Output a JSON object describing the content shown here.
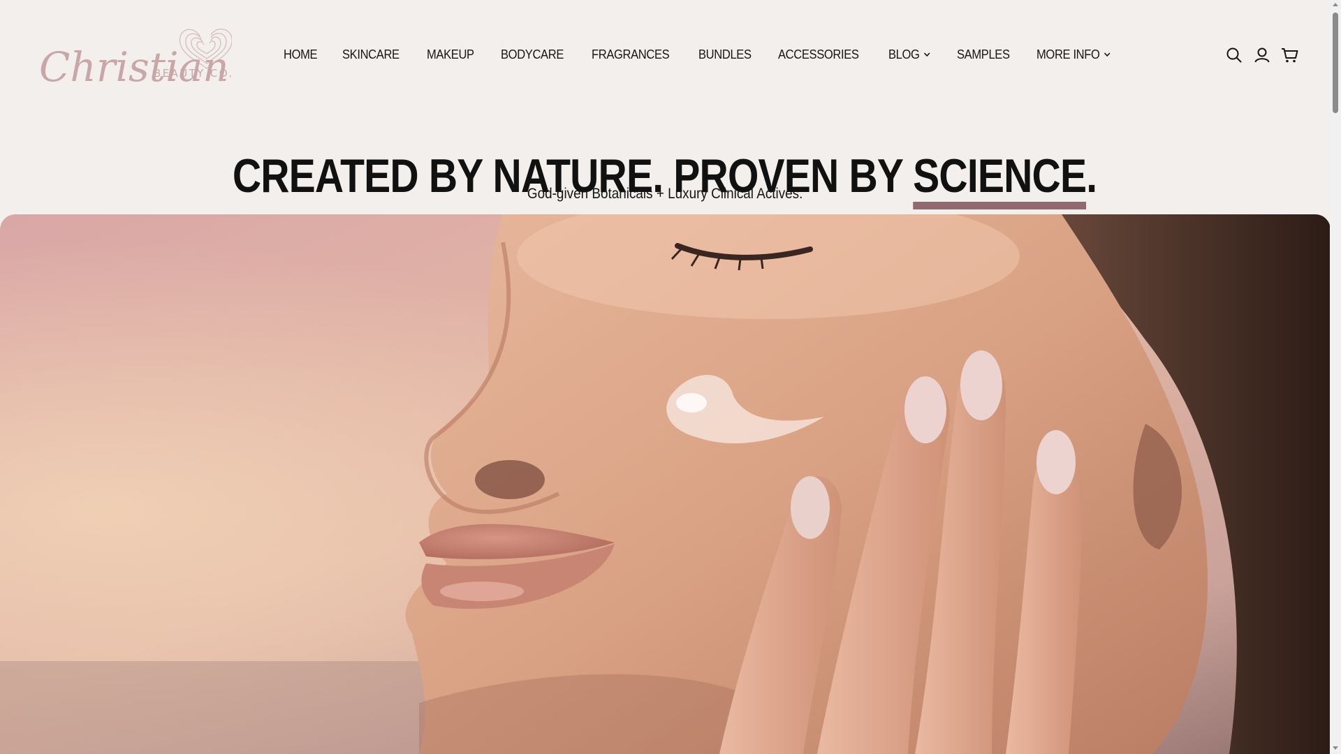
{
  "brand": {
    "logo_name": "Christian",
    "logo_suffix": "BEAUTY CO.",
    "logo_color": "#c9a7a7"
  },
  "nav": {
    "items": [
      {
        "label": "HOME",
        "has_dropdown": false
      },
      {
        "label": "SKINCARE",
        "has_dropdown": false
      },
      {
        "label": "MAKEUP",
        "has_dropdown": false
      },
      {
        "label": "BODYCARE",
        "has_dropdown": false
      },
      {
        "label": "FRAGRANCES",
        "has_dropdown": false
      },
      {
        "label": "BUNDLES",
        "has_dropdown": false
      },
      {
        "label": "ACCESSORIES",
        "has_dropdown": false
      },
      {
        "label": "BLOG",
        "has_dropdown": true
      },
      {
        "label": "SAMPLES",
        "has_dropdown": false
      },
      {
        "label": "MORE INFO",
        "has_dropdown": true
      }
    ]
  },
  "header_icons": [
    "search-icon",
    "account-icon",
    "cart-icon"
  ],
  "hero": {
    "headline_prefix": "CREATED BY NATURE. PROVEN BY ",
    "headline_accent": "SCIENCE",
    "headline_suffix": ".",
    "subheadline": "God-given Botanicals + Luxury Clinical Actives.",
    "accent_color": "#8f6a6e"
  },
  "colors": {
    "background": "#f2efed",
    "text": "#111111"
  }
}
